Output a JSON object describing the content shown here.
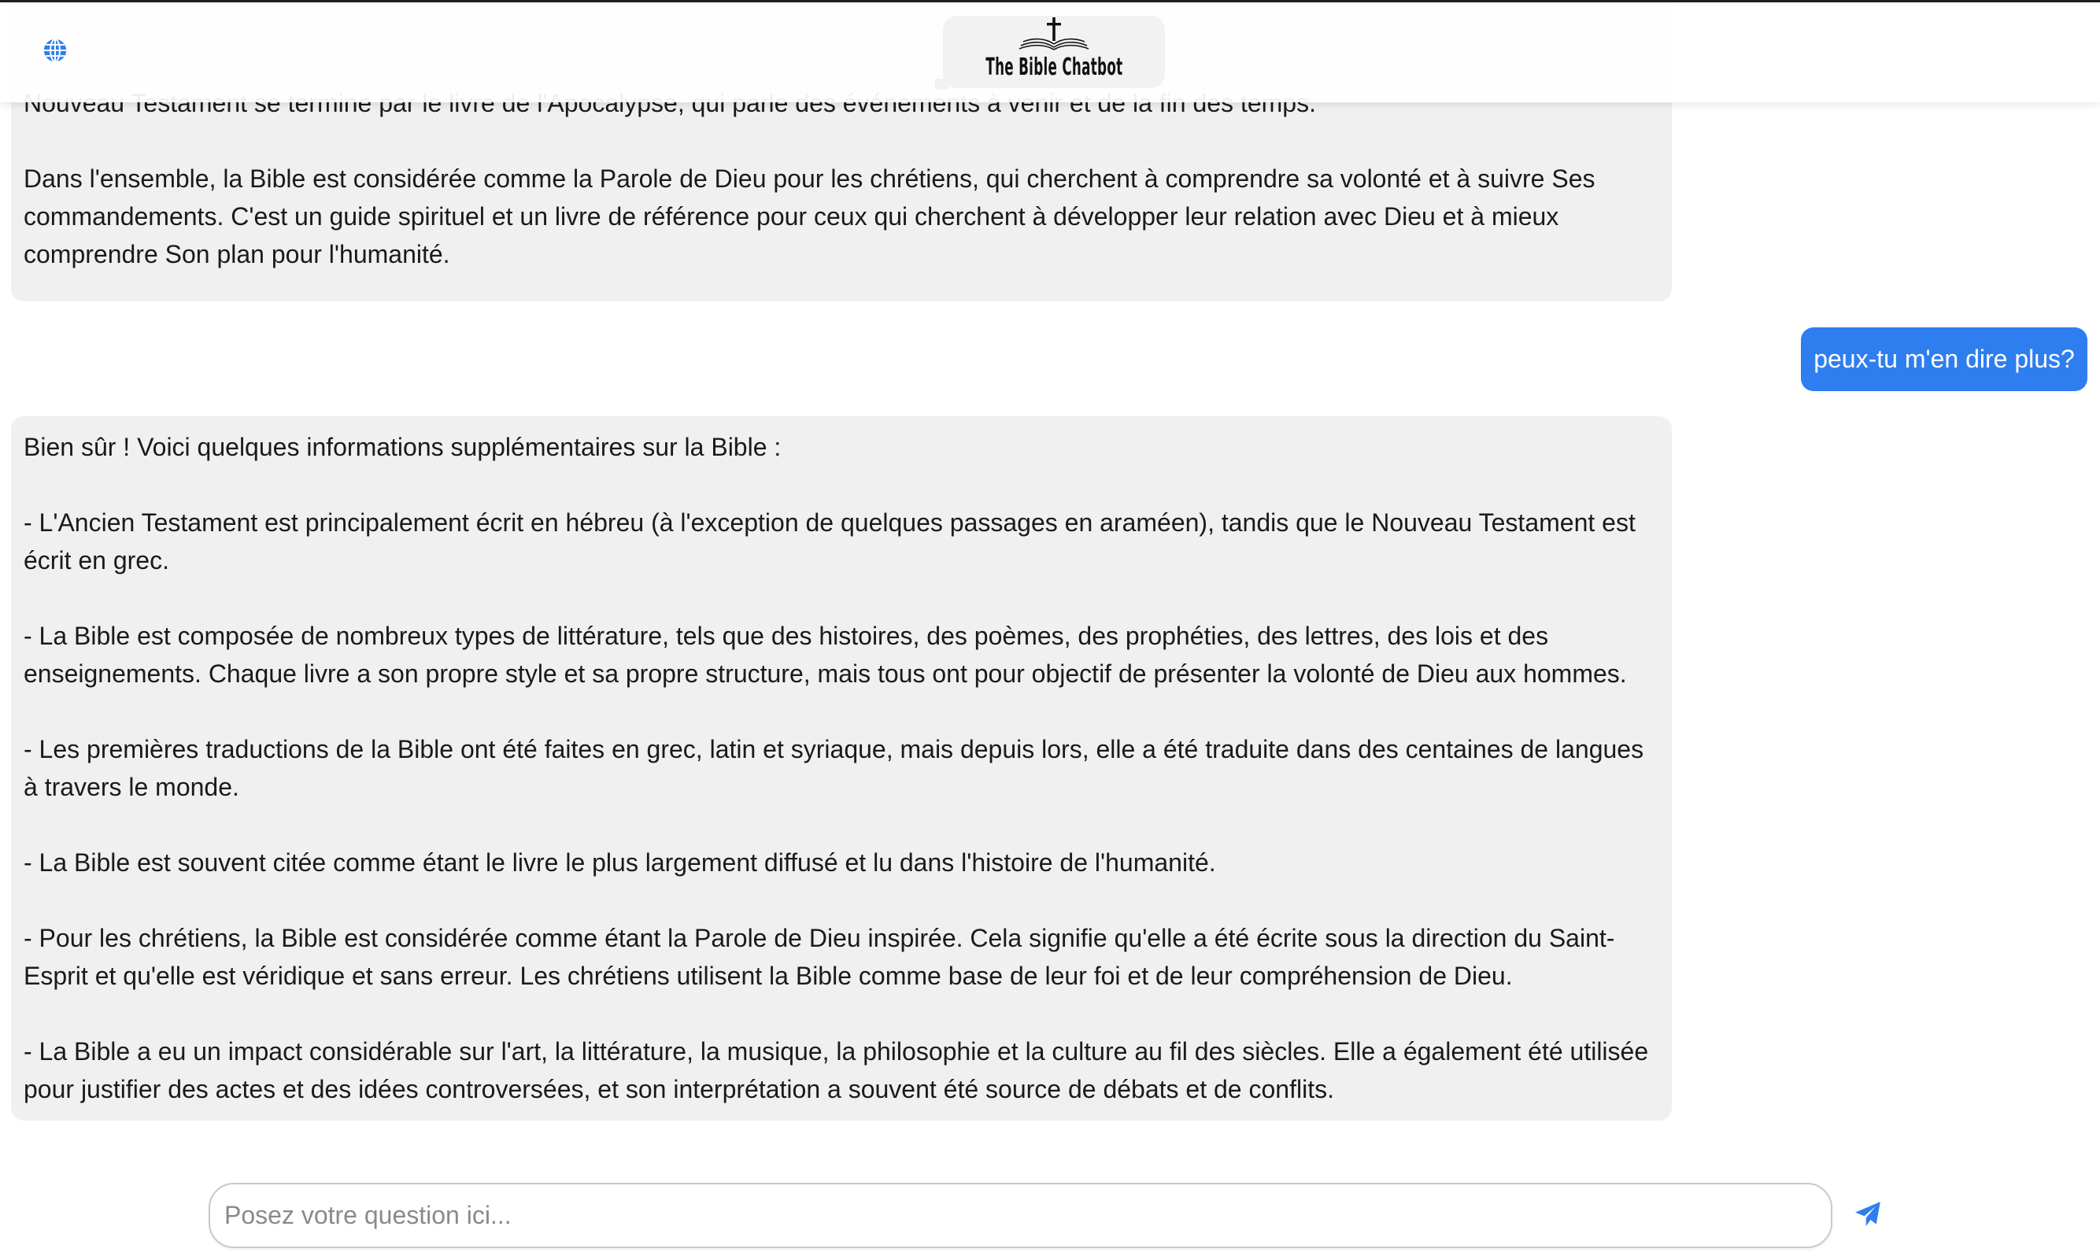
{
  "header": {
    "globe_icon": "globe-icon",
    "logo_text": "The Bible Chatbot",
    "logo_icon": "cross-open-book-icon"
  },
  "conversation": {
    "bot_message_1": {
      "paragraphs": [
        "Nouveau Testament se termine par le livre de l'Apocalypse, qui parle des événements à venir et de la fin des temps.",
        "Dans l'ensemble, la Bible est considérée comme la Parole de Dieu pour les chrétiens, qui cherchent à comprendre sa volonté et à suivre Ses commandements. C'est un guide spirituel et un livre de référence pour ceux qui cherchent à développer leur relation avec Dieu et à mieux comprendre Son plan pour l'humanité."
      ]
    },
    "user_message": "peux-tu m'en dire plus?",
    "bot_message_2": {
      "paragraphs": [
        "Bien sûr ! Voici quelques informations supplémentaires sur la Bible :",
        "- L'Ancien Testament est principalement écrit en hébreu (à l'exception de quelques passages en araméen), tandis que le Nouveau Testament est écrit en grec.",
        "- La Bible est composée de nombreux types de littérature, tels que des histoires, des poèmes, des prophéties, des lettres, des lois et des enseignements. Chaque livre a son propre style et sa propre structure, mais tous ont pour objectif de présenter la volonté de Dieu aux hommes.",
        "- Les premières traductions de la Bible ont été faites en grec, latin et syriaque, mais depuis lors, elle a été traduite dans des centaines de langues à travers le monde.",
        "- La Bible est souvent citée comme étant le livre le plus largement diffusé et lu dans l'histoire de l'humanité.",
        "- Pour les chrétiens, la Bible est considérée comme étant la Parole de Dieu inspirée. Cela signifie qu'elle a été écrite sous la direction du Saint-Esprit et qu'elle est véridique et sans erreur. Les chrétiens utilisent la Bible comme base de leur foi et de leur compréhension de Dieu.",
        "- La Bible a eu un impact considérable sur l'art, la littérature, la musique, la philosophie et la culture au fil des siècles. Elle a également été utilisée pour justifier des actes et des idées controversées, et son interprétation a souvent été source de débats et de conflits."
      ]
    }
  },
  "composer": {
    "placeholder": "Posez votre question ici...",
    "value": "",
    "send_icon": "paper-plane-icon"
  },
  "colors": {
    "accent": "#2f7ef0",
    "bot_bubble": "#f0f0f0",
    "user_text": "#ffffff"
  }
}
